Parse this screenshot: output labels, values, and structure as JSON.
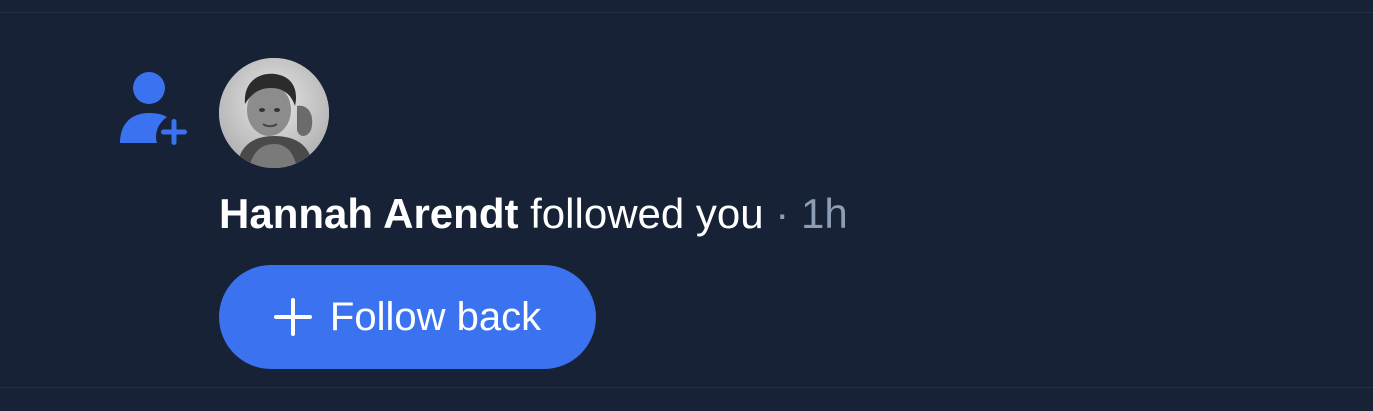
{
  "notification": {
    "type_icon": "user-plus-icon",
    "avatar_icon": "user-avatar",
    "user_name": "Hannah Arendt",
    "action": "followed you",
    "separator": "·",
    "time": "1h",
    "button": {
      "icon": "plus-icon",
      "label": "Follow back"
    }
  },
  "colors": {
    "background": "#172236",
    "accent": "#3a72f0",
    "text": "#ffffff",
    "muted": "#8d9db6"
  }
}
